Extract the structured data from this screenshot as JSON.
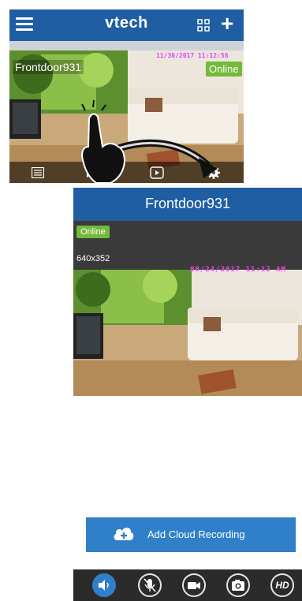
{
  "list_view": {
    "header": {
      "logo_text": "vtech",
      "menu_icon": "hamburger-icon",
      "grid_icon": "grid-view-icon",
      "add_icon": "plus-icon"
    },
    "camera_card": {
      "name": "Frontdoor931",
      "status": "Online",
      "timestamp": "11/30/2017 11:12:58"
    },
    "bottom_bar_icons": [
      "list-icon",
      "playback-icon",
      "video-icon",
      "settings-icon"
    ]
  },
  "detail_view": {
    "title": "Frontdoor931",
    "status": "Online",
    "resolution": "640x352",
    "timestamp": "08/24/2017 11:12 AM",
    "cloud_button": {
      "label": "Add Cloud Recording",
      "icon": "cloud-plus-icon"
    },
    "controls": [
      {
        "name": "speaker-icon",
        "active": true
      },
      {
        "name": "mute-mic-icon",
        "active": false
      },
      {
        "name": "video-record-icon",
        "active": false
      },
      {
        "name": "snapshot-icon",
        "active": false
      },
      {
        "name": "hd-icon",
        "active": false,
        "label": "HD"
      }
    ]
  },
  "colors": {
    "header": "#1f5ea3",
    "online": "#73b93a",
    "button": "#2f80c8"
  }
}
